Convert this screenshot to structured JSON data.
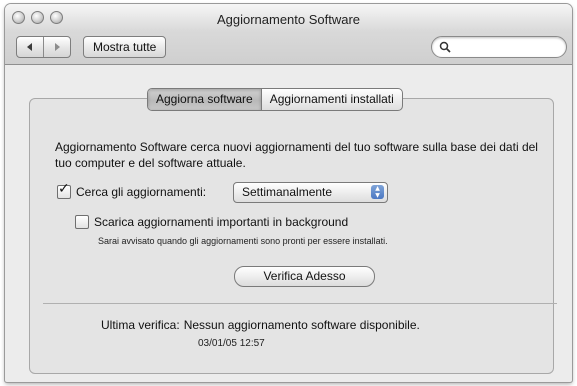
{
  "window": {
    "title": "Aggiornamento Software"
  },
  "toolbar": {
    "back_icon": "back-arrow-icon",
    "forward_icon": "forward-arrow-icon",
    "show_all_label": "Mostra tutte",
    "search_value": ""
  },
  "tabs": [
    {
      "label": "Aggiorna software",
      "active": true
    },
    {
      "label": "Aggiornamenti installati",
      "active": false
    }
  ],
  "main": {
    "description": "Aggiornamento Software cerca nuovi aggiornamenti del tuo software sulla base dei dati del tuo computer e del software attuale.",
    "check_updates": {
      "label": "Cerca gli aggiornamenti:",
      "checked": true
    },
    "frequency": {
      "selected": "Settimanalmente"
    },
    "download_background": {
      "label": "Scarica aggiornamenti importanti in background",
      "checked": false
    },
    "download_note": "Sarai avvisato quando gli aggiornamenti sono pronti per essere installati.",
    "verify_button": "Verifica Adesso",
    "last_check_label": "Ultima verifica:",
    "last_check_value": "Nessun aggiornamento software disponibile.",
    "last_check_time": "03/01/05 12:57"
  },
  "colors": {
    "popup_arrows": "#4c78c3",
    "window_bg": "#ececec"
  }
}
